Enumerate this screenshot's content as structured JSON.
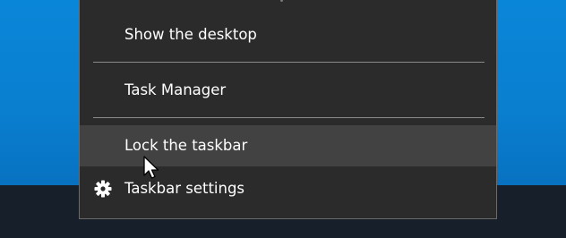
{
  "context_menu": {
    "items": [
      {
        "label": "Show the desktop",
        "icon": null
      },
      {
        "label": "Task Manager",
        "icon": null
      },
      {
        "label": "Lock the taskbar",
        "icon": null,
        "state": "hovered"
      },
      {
        "label": "Taskbar settings",
        "icon": "gear-icon"
      }
    ]
  },
  "colors": {
    "menu_background": "#2b2b2b",
    "menu_hover": "#424242",
    "menu_border": "#6a6a6a",
    "separator": "#8a8a8a",
    "text": "#ffffff",
    "desktop": "#0a7fd0",
    "taskbar": "#17202a"
  }
}
